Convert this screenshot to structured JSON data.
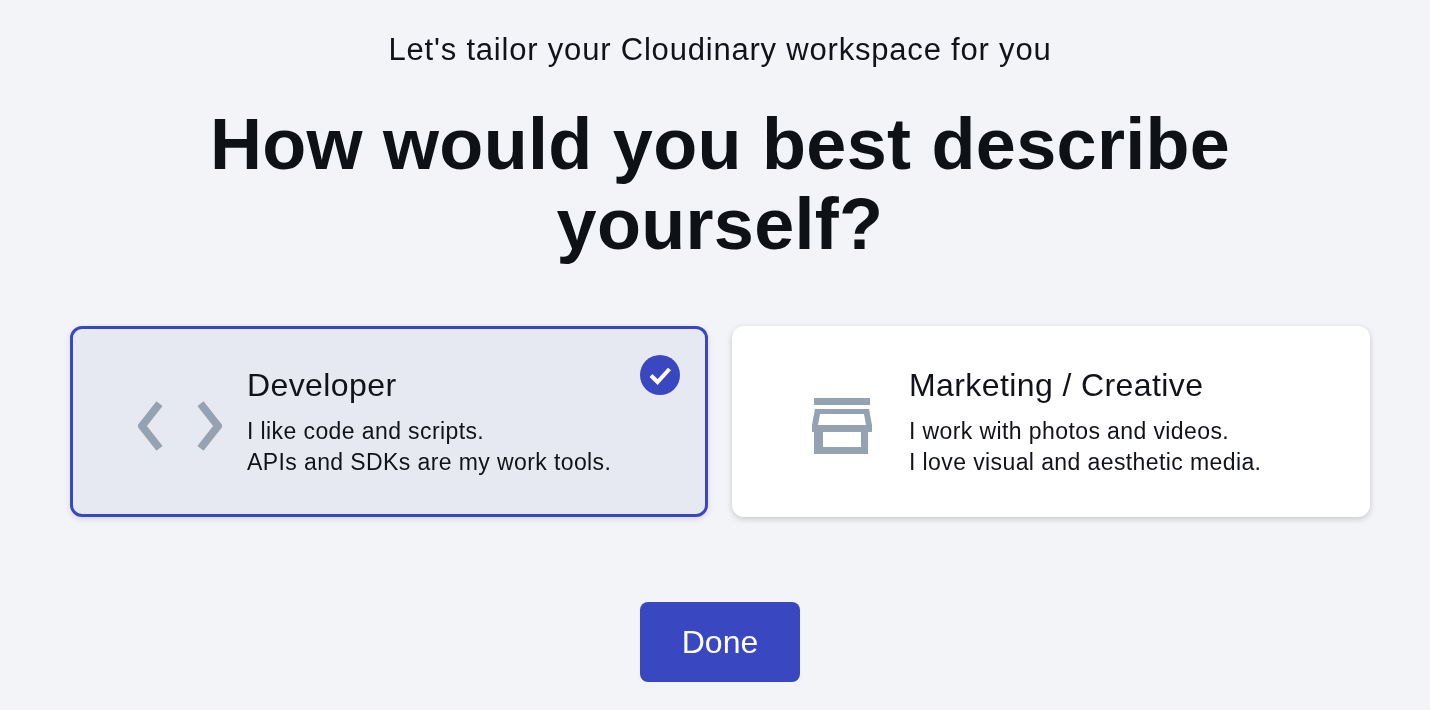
{
  "subtitle": "Let's tailor your Cloudinary workspace for you",
  "heading": "How would you best describe yourself?",
  "options": [
    {
      "kind": "code",
      "title": "Developer",
      "lines": [
        "I like code and scripts.",
        "APIs and SDKs are my work tools."
      ],
      "selected": true
    },
    {
      "kind": "store",
      "title": "Marketing / Creative",
      "lines": [
        "I work with photos and videos.",
        "I love visual and aesthetic media."
      ],
      "selected": false
    }
  ],
  "done_button": {
    "label": "Done"
  }
}
